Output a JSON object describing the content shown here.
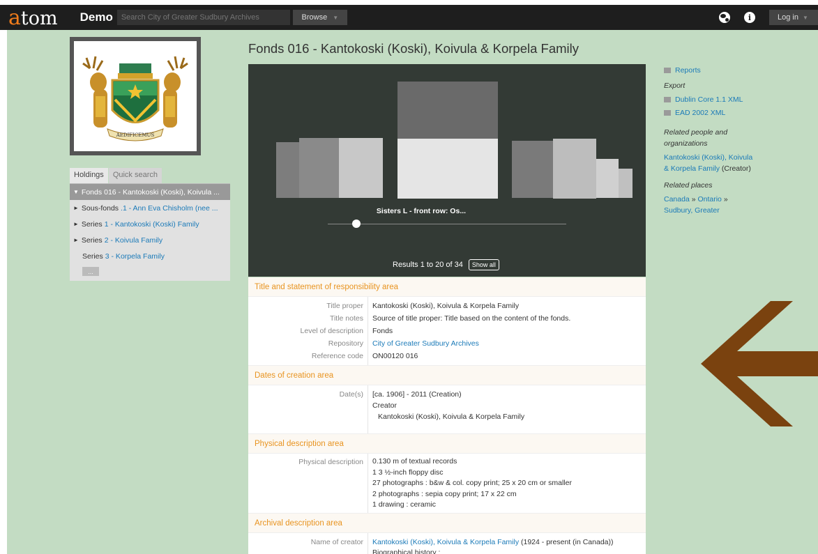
{
  "header": {
    "logo_a": "a",
    "logo_rest": "tom",
    "site_name": "Demo",
    "search_placeholder": "Search City of Greater Sudbury Archives",
    "browse_label": "Browse",
    "login_label": "Log in"
  },
  "sidebar": {
    "crest_motto": "AEDIFICEMUS",
    "tabs": [
      "Holdings",
      "Quick search"
    ],
    "tree": [
      {
        "level": "Fonds",
        "title": "016 - Kantokoski (Koski), Koivula ..."
      },
      {
        "level": "Sous-fonds",
        "title": ".1 - Ann Eva Chisholm (nee ..."
      },
      {
        "level": "Series",
        "title": "1 - Kantokoski (Koski) Family"
      },
      {
        "level": "Series",
        "title": "2 - Koivula Family"
      },
      {
        "level": "Series",
        "title": "3 - Korpela Family"
      }
    ],
    "more_label": "..."
  },
  "main": {
    "title": "Fonds 016 - Kantokoski (Koski), Koivula & Korpela Family",
    "carousel": {
      "caption": "Sisters L - front row: Os...",
      "results_text": "Results 1 to 20 of 34",
      "show_all_label": "Show all"
    },
    "sections": {
      "title_area": {
        "heading": "Title and statement of responsibility area",
        "labels": [
          "Title proper",
          "Title notes",
          "Level of description",
          "Repository",
          "Reference code"
        ],
        "title_proper": "Kantokoski (Koski), Koivula & Korpela Family",
        "title_notes": "Source of title proper: Title based on the content of the fonds.",
        "level": "Fonds",
        "repository": "City of Greater Sudbury Archives",
        "reference_code": "ON00120 016"
      },
      "dates_area": {
        "heading": "Dates of creation area",
        "label": "Date(s)",
        "date": "[ca. 1906] - 2011 (Creation)",
        "creator_label": "Creator",
        "creator": "Kantokoski (Koski), Koivula & Korpela Family"
      },
      "physical_area": {
        "heading": "Physical description area",
        "label": "Physical description",
        "lines": [
          "0.130 m of textual records",
          "1 3 ½-inch floppy disc",
          "27 photographs : b&w & col. copy print; 25 x 20 cm or smaller",
          "2 photographs : sepia copy print; 17 x 22 cm",
          "1 drawing : ceramic"
        ]
      },
      "archival_area": {
        "heading": "Archival description area",
        "label": "Name of creator",
        "creator_link": "Kantokoski (Koski), Koivula & Korpela Family",
        "creator_suffix": " (1924 - present (in Canada))",
        "bio_label": "Biographical history :"
      }
    }
  },
  "right": {
    "reports_label": "Reports",
    "export_heading": "Export",
    "export_links": [
      "Dublin Core 1.1 XML",
      "EAD 2002 XML"
    ],
    "related_people_heading_1": "Related people and",
    "related_people_heading_2": "organizations",
    "related_person_line1": "Kantokoski (Koski), Koivula",
    "related_person_line2": "& Korpela Family",
    "related_person_role": " (Creator)",
    "related_places_heading": "Related places",
    "places": [
      "Canada",
      "Ontario",
      "Sudbury, Greater"
    ],
    "place_separator": " » "
  },
  "colors": {
    "accent_orange": "#f07c1b",
    "section_heading": "#e8931f",
    "link": "#1b7ab8",
    "green_bg": "#c3dcc3",
    "arrow_brown": "#7a420f"
  }
}
